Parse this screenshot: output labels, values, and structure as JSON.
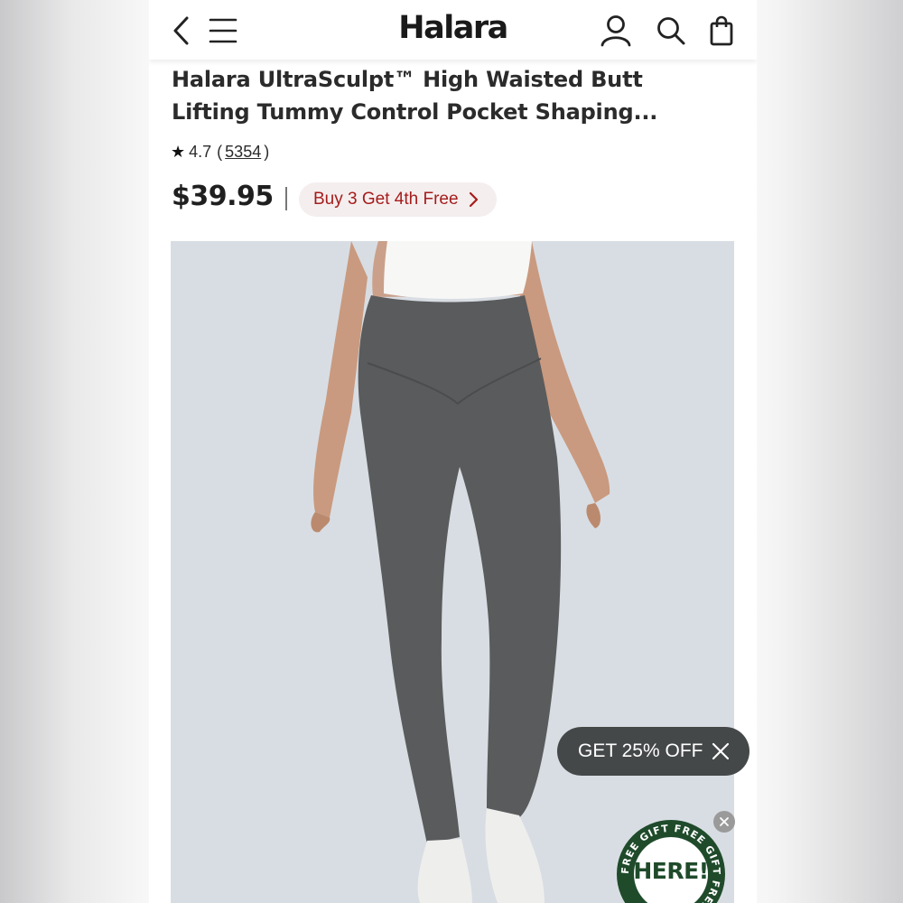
{
  "header": {
    "logo": "Halara",
    "icons": [
      "back-icon",
      "menu-icon",
      "account-icon",
      "search-icon",
      "bag-icon"
    ]
  },
  "product": {
    "title_line1": "Halara UltraSculpt™ High Waisted Butt",
    "title_line2": "Lifting Tummy Control Pocket Shaping...",
    "rating": "4.7",
    "rating_open": "(",
    "review_count": "5354",
    "rating_close": ")",
    "price": "$39.95",
    "promo": "Buy 3 Get 4th Free"
  },
  "popups": {
    "discount": "GET 25% OFF",
    "gift_ring": "FREE GIFT FREE GIFT FREE GIFT",
    "gift_center": "HERE!"
  },
  "colors": {
    "promo_text": "#a51c1c",
    "promo_bg": "#f5eeee",
    "photo_bg": "#d8dde3",
    "leggings": "#5a5b5c",
    "discount_bg": "#454848",
    "gift_green": "#1f4b2b"
  }
}
